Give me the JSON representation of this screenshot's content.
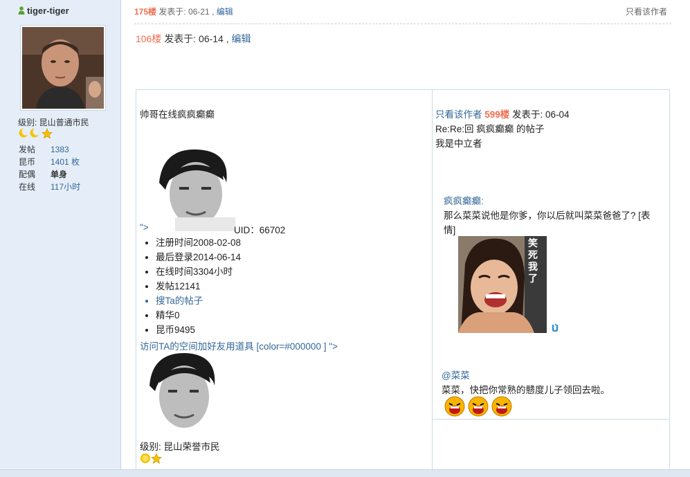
{
  "profile": {
    "username": "tiger-tiger",
    "level_label": "级别: 昆山普通市民",
    "stats": [
      {
        "key": "发帖",
        "value": "1383"
      },
      {
        "key": "昆币",
        "value": "1401 枚"
      },
      {
        "key": "配偶",
        "value": "单身"
      },
      {
        "key": "在线",
        "value": "117小时"
      }
    ]
  },
  "post": {
    "floor": "175楼",
    "posted_label": "发表于: 06-21",
    "sep": " , ",
    "edit_label": "编辑",
    "only_author": "只看该作者"
  },
  "quote_head": {
    "floor": "106楼",
    "posted_label": " 发表于: 06-14 , ",
    "edit_label": "编辑"
  },
  "left_cell": {
    "title": "帅哥在线疯疯癫癫",
    "broken_attr": "\">",
    "uid": "UID：66702",
    "info": [
      "注册时间2008-02-08",
      "最后登录2014-06-14",
      "在线时间3304小时",
      "发帖12141",
      "搜Ta的帖子",
      "精华0",
      "昆币9495"
    ],
    "visit_link": "访问TA的空间加好友用道具 [color=#000000 ] \">",
    "level_label": "级别: 昆山荣誉市民"
  },
  "right_cell": {
    "only_author": "只看该作者",
    "floor": "599楼",
    "posted_label": " 发表于: 06-04",
    "reply_title": "Re:Re:回 疯疯癫癫 的帖子",
    "reply_text": "我是中立者",
    "quote_user": "疯疯癫癫:",
    "quote_text_1": "那么菜菜说他是你爹，你以后就叫菜菜爸爸了? [表",
    "quote_text_2": "情]",
    "image_caption": "笑死我了",
    "mention": "@菜菜",
    "mention_text": "菜菜，快把你常熟的戆度儿子领回去啦。"
  }
}
